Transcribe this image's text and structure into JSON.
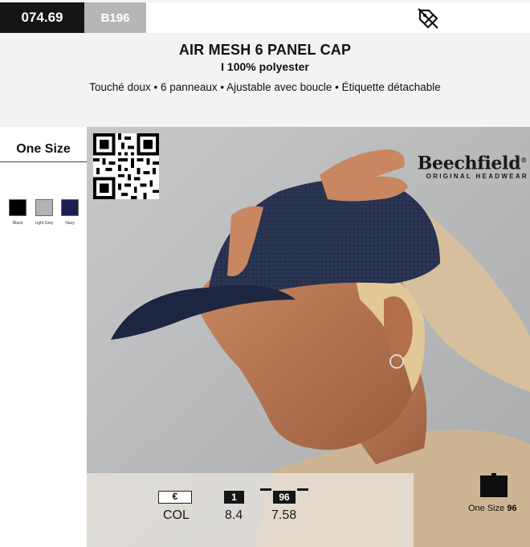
{
  "header": {
    "product_code": "074.69",
    "reference": "B196",
    "tag_icon": "discount-tag-icon"
  },
  "product": {
    "title": "AIR MESH 6 PANEL CAP",
    "subtitle": "I 100% polyester",
    "features": "Touché doux • 6 panneaux • Ajustable avec boucle • Étiquette détachable"
  },
  "sizes": {
    "label": "One Size"
  },
  "colors": [
    {
      "name": "Black",
      "hex": "#000000"
    },
    {
      "name": "Light Grey",
      "hex": "#b3b3b3"
    },
    {
      "name": "Navy",
      "hex": "#1a2150"
    }
  ],
  "brand": {
    "name": "Beechfield",
    "registered": "®",
    "tagline": "ORIGINAL HEADWEAR"
  },
  "pricing": {
    "currency_symbol": "€",
    "col_label": "COL",
    "qty_1": "1",
    "price_1": "8.4",
    "qty_2": "96",
    "price_2": "7.58"
  },
  "packing": {
    "size_label": "One Size",
    "quantity": "96"
  }
}
